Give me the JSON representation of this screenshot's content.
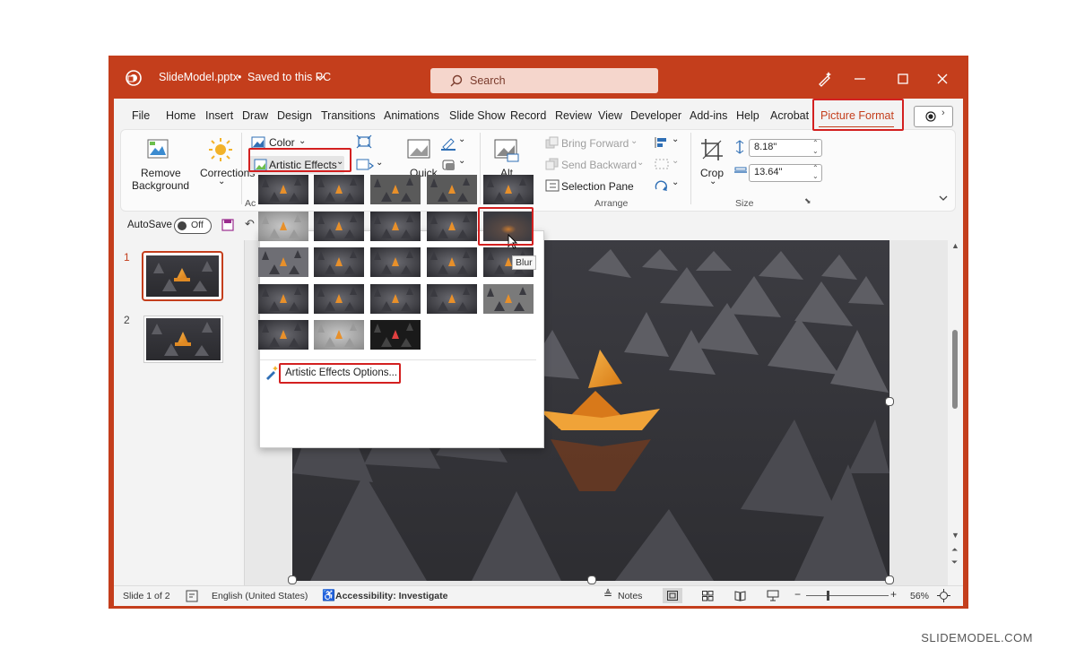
{
  "window": {
    "title": "SlideModel.pptx",
    "save_status": "Saved to this PC",
    "search_placeholder": "Search",
    "accent_color": "#c43e1c"
  },
  "menu": {
    "items": [
      "File",
      "Home",
      "Insert",
      "Draw",
      "Design",
      "Transitions",
      "Animations",
      "Slide Show",
      "Record",
      "Review",
      "View",
      "Developer",
      "Add-ins",
      "Help",
      "Acrobat",
      "Picture Format"
    ],
    "active": "Picture Format"
  },
  "ribbon": {
    "remove_background": "Remove Background",
    "remove_line1": "Remove",
    "remove_line2": "Background",
    "corrections": "Corrections",
    "color": "Color",
    "artistic_effects": "Artistic Effects",
    "quick": "Quick",
    "alt": "Alt",
    "bring_forward": "Bring Forward",
    "send_backward": "Send Backward",
    "selection_pane": "Selection Pane",
    "arrange_group": "Arrange",
    "crop": "Crop",
    "height": "8.18\"",
    "width": "13.64\"",
    "size_group": "Size",
    "adjust_group_partial": "Ac"
  },
  "qat": {
    "autosave": "AutoSave",
    "toggle_state": "Off"
  },
  "slides": {
    "numbers": [
      "1",
      "2"
    ]
  },
  "gallery": {
    "tooltip": "Blur",
    "options_label": "Artistic Effects Options..."
  },
  "statusbar": {
    "slide_info": "Slide 1 of 2",
    "language": "English (United States)",
    "accessibility": "Accessibility: Investigate",
    "notes": "Notes",
    "zoom": "56%"
  },
  "watermark": "SLIDEMODEL.COM"
}
